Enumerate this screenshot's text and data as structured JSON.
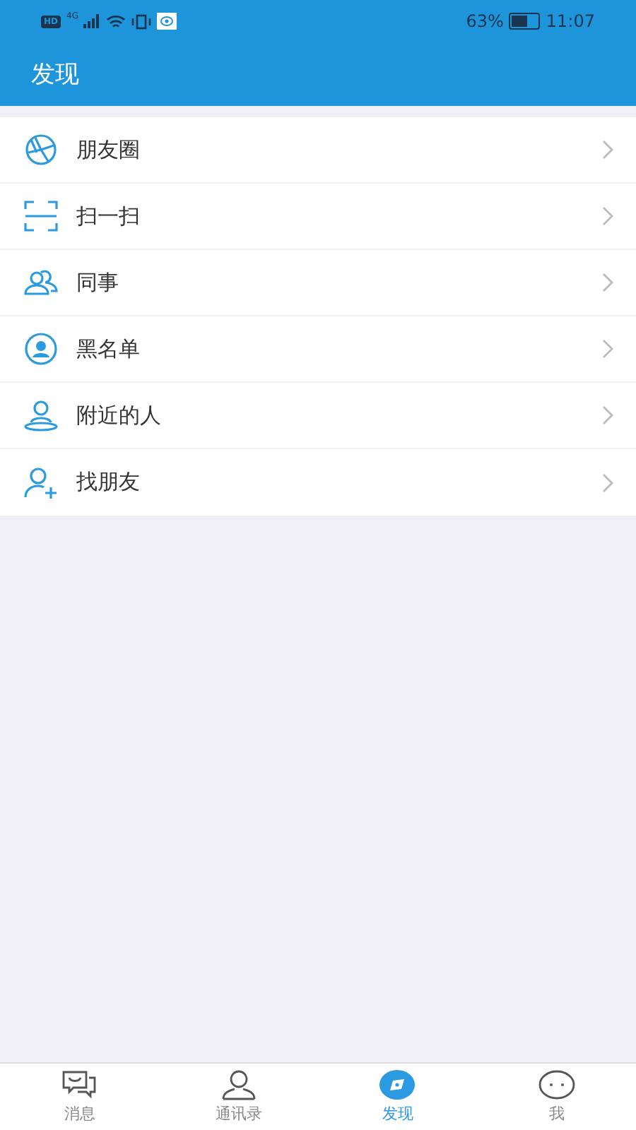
{
  "status_bar": {
    "network_badge": "HD",
    "network_type": "4G",
    "battery_percent": "63%",
    "time": "11:07"
  },
  "header": {
    "title": "发现"
  },
  "menu": [
    {
      "kind": "moments",
      "label": "朋友圈"
    },
    {
      "kind": "scan",
      "label": "扫一扫"
    },
    {
      "kind": "colleagues",
      "label": "同事"
    },
    {
      "kind": "blacklist",
      "label": "黑名单"
    },
    {
      "kind": "nearby",
      "label": "附近的人"
    },
    {
      "kind": "add-friend",
      "label": "找朋友"
    }
  ],
  "tab_bar": [
    {
      "kind": "messages",
      "label": "消息",
      "selected": false
    },
    {
      "kind": "contacts",
      "label": "通讯录",
      "selected": false
    },
    {
      "kind": "discover",
      "label": "发现",
      "selected": true
    },
    {
      "kind": "me",
      "label": "我",
      "selected": false
    }
  ]
}
